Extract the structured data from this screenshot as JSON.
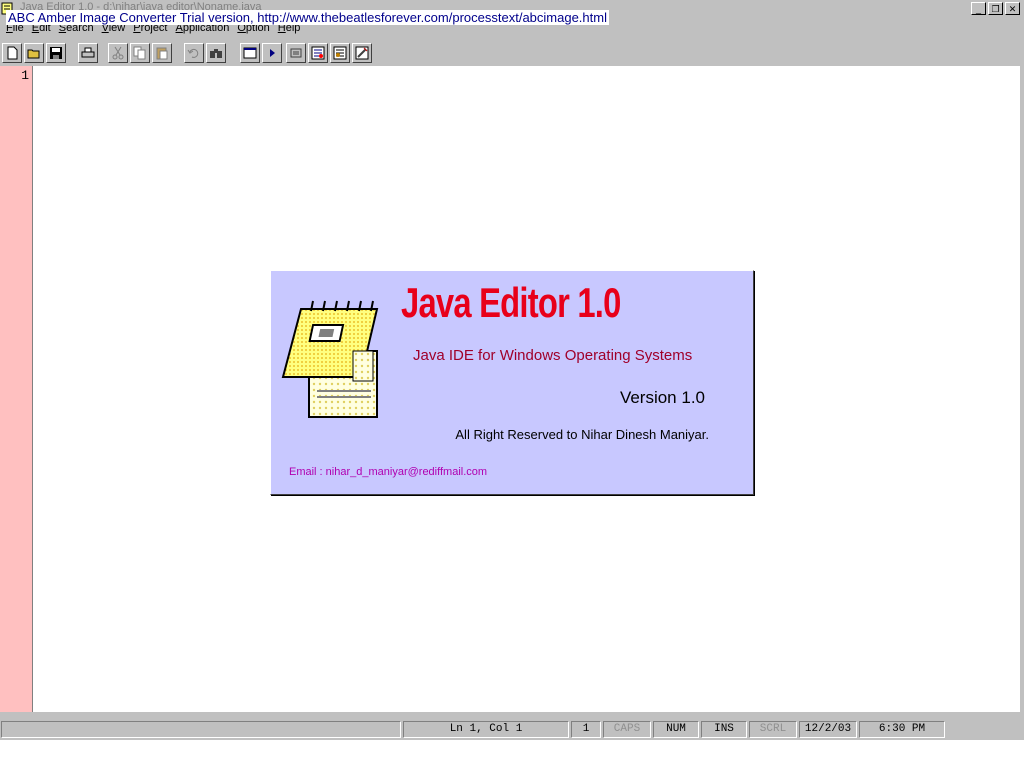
{
  "window": {
    "title": "Java Editor 1.0  -  d:\\nihar\\java editor\\Noname.java",
    "watermark": "ABC Amber Image Converter Trial version, http://www.thebeatlesforever.com/processtext/abcimage.html",
    "controls": [
      "minimize-icon",
      "restore-icon",
      "close-icon"
    ]
  },
  "menu": [
    "File",
    "Edit",
    "Search",
    "View",
    "Project",
    "Application",
    "Option",
    "Help"
  ],
  "toolbar": {
    "buttons": [
      "new-file-icon",
      "open-folder-icon",
      "save-icon",
      "print-icon",
      "cut-icon",
      "copy-icon",
      "paste-icon",
      "undo-icon",
      "find-icon",
      "window-icon",
      "run-icon",
      "compile-icon",
      "applet-icon",
      "debug-icon",
      "tools-icon"
    ]
  },
  "editor": {
    "line_numbers": [
      "1"
    ],
    "gutter_color": "#ffc0c0"
  },
  "splash": {
    "title": "Java Editor 1.0",
    "subtitle": "Java IDE for Windows Operating Systems",
    "version": "Version 1.0",
    "rights": "All Right Reserved to Nihar Dinesh Maniyar.",
    "email": "Email :  nihar_d_maniyar@rediffmail.com",
    "background": "#c8c8ff",
    "title_color": "#e8001a"
  },
  "status": {
    "message": "",
    "position": "Ln 1, Col 1",
    "count": "1",
    "caps": "CAPS",
    "num": "NUM",
    "ins": "INS",
    "scrl": "SCRL",
    "date": "12/2/03",
    "time": "6:30 PM"
  }
}
